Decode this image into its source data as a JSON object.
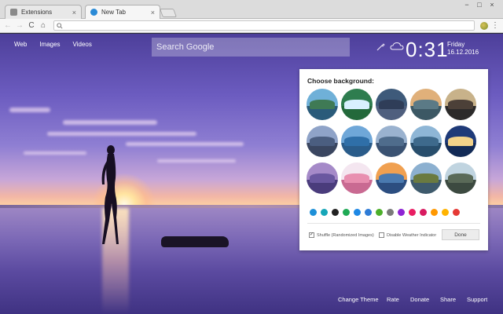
{
  "browser": {
    "tabs": [
      {
        "title": "Extensions",
        "active": false,
        "icon": "puzzle-icon"
      },
      {
        "title": "New Tab",
        "active": true,
        "icon": "chrome-tab-icon"
      }
    ],
    "close_glyph": "×",
    "window_controls": [
      "−",
      "□",
      "×"
    ],
    "toolbar": {
      "back": "←",
      "forward": "→",
      "reload": "C",
      "home": "⌂"
    },
    "omnibox_value": ""
  },
  "page_nav": {
    "web": "Web",
    "images": "Images",
    "videos": "Videos"
  },
  "search": {
    "placeholder": "Search Google"
  },
  "clock": {
    "time": "0:31",
    "day": "Friday",
    "date": "16.12.2016"
  },
  "background_picker": {
    "title": "Choose background:",
    "thumbnails": [
      {
        "sky": "#6fb0d8",
        "mid": "#3f7a55",
        "land": "#2a5b7a"
      },
      {
        "sky": "#2e7d4f",
        "mid": "#d8f0ff",
        "land": "#23693b"
      },
      {
        "sky": "#3e5a7a",
        "mid": "#2f3d58",
        "land": "#4f5f7e"
      },
      {
        "sky": "#e0b07a",
        "mid": "#5b7a86",
        "land": "#3c5864"
      },
      {
        "sky": "#c8b28a",
        "mid": "#4c4038",
        "land": "#2c2a2a"
      },
      {
        "sky": "#8fa3c8",
        "mid": "#4b5e80",
        "land": "#3a4660"
      },
      {
        "sky": "#6fa7d8",
        "mid": "#2f6fa8",
        "land": "#2a5c8a"
      },
      {
        "sky": "#9ab2cf",
        "mid": "#4f6c8c",
        "land": "#3a5272"
      },
      {
        "sky": "#8eb6d6",
        "mid": "#3e6a8c",
        "land": "#284e6c"
      },
      {
        "sky": "#1e3a78",
        "mid": "#f2d28a",
        "land": "#122a56"
      },
      {
        "sky": "#a58ac8",
        "mid": "#6a58a0",
        "land": "#4a3c7c"
      },
      {
        "sky": "#f4e6f0",
        "mid": "#e88fb0",
        "land": "#c96a92"
      },
      {
        "sky": "#f0a050",
        "mid": "#4a7ab0",
        "land": "#2c4e80"
      },
      {
        "sky": "#8cb0d0",
        "mid": "#6a7a40",
        "land": "#3e5a6c"
      },
      {
        "sky": "#c0d4e0",
        "mid": "#5a6a58",
        "land": "#3c4a40"
      }
    ],
    "swatches": [
      "#1e90d8",
      "#17a6b8",
      "#222222",
      "#1faa55",
      "#1e88e5",
      "#2e7bd6",
      "#4caf2a",
      "#7a7a7a",
      "#8e24d4",
      "#e91e63",
      "#d81b60",
      "#ff9800",
      "#ffb300",
      "#e53935"
    ],
    "shuffle_label": "Shuffle (Randomized Images)",
    "shuffle_checked": true,
    "weather_label": "Disable Weather Indicator",
    "weather_checked": false,
    "done_label": "Done"
  },
  "footer": {
    "change_theme": "Change Theme",
    "rate": "Rate",
    "donate": "Donate",
    "share": "Share",
    "support": "Support"
  }
}
